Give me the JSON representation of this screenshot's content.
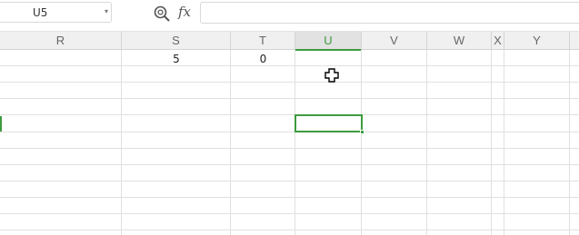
{
  "formula_bar": {
    "name_box_value": "U5",
    "fx_label": "fx",
    "formula_value": ""
  },
  "columns": [
    {
      "label": "R"
    },
    {
      "label": "S"
    },
    {
      "label": "T"
    },
    {
      "label": "U",
      "active": true
    },
    {
      "label": "V"
    },
    {
      "label": "W"
    },
    {
      "label": "X"
    },
    {
      "label": "Y"
    }
  ],
  "cells": {
    "S1": "5",
    "T1": "0"
  },
  "selection": {
    "active_cell": "U5",
    "accent_color": "#3e9b3e"
  },
  "icons": [
    "zoom-formula-icon",
    "chevron-down-icon",
    "crosshair-cursor-icon"
  ]
}
